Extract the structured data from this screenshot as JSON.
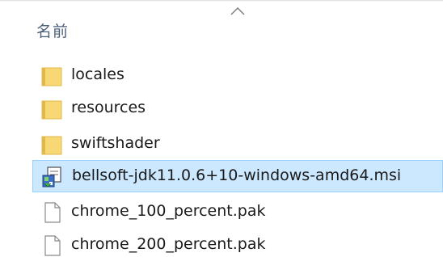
{
  "header": {
    "column_name_label": "名前",
    "sort_indicator_icon": "chevron-up-icon"
  },
  "files": [
    {
      "name": "locales",
      "type": "folder",
      "icon": "folder-icon",
      "selected": false
    },
    {
      "name": "resources",
      "type": "folder",
      "icon": "folder-icon",
      "selected": false
    },
    {
      "name": "swiftshader",
      "type": "folder",
      "icon": "folder-icon",
      "selected": false
    },
    {
      "name": "bellsoft-jdk11.0.6+10-windows-amd64.msi",
      "type": "installer",
      "icon": "msi-installer-icon",
      "selected": true
    },
    {
      "name": "chrome_100_percent.pak",
      "type": "file",
      "icon": "document-icon",
      "selected": false
    },
    {
      "name": "chrome_200_percent.pak",
      "type": "file",
      "icon": "document-icon",
      "selected": false
    }
  ],
  "colors": {
    "selection_fill": "#cce8ff",
    "selection_border": "#99d1ff",
    "header_text": "#4c607a",
    "folder_yellow": "#f8d775",
    "folder_dark": "#e0b94a"
  }
}
